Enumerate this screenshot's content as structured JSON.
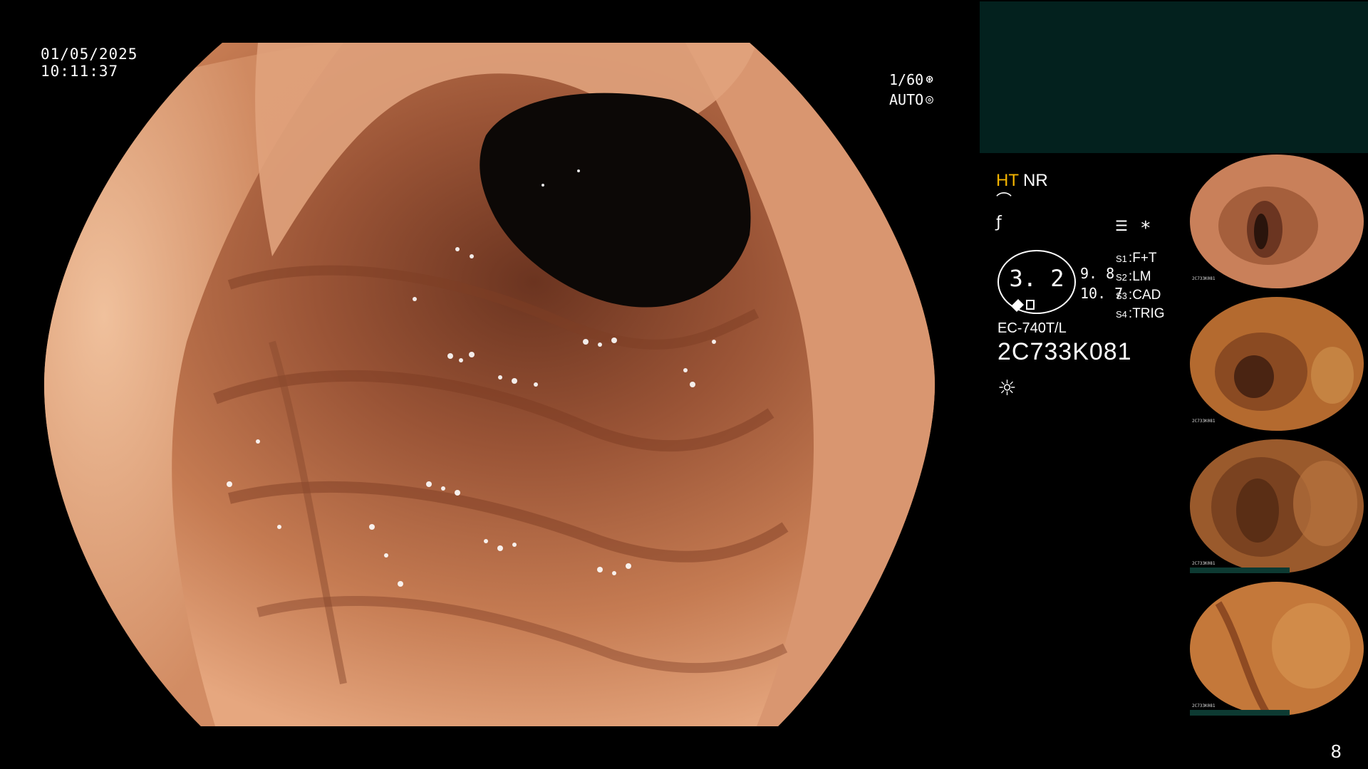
{
  "overlay": {
    "date": "01/05/2025",
    "time": "10:11:37",
    "shutter_speed": "1/60",
    "shutter_icon": "aperture-icon",
    "exposure_mode": "AUTO",
    "exposure_icon": "iris-icon"
  },
  "panel": {
    "mode_ht": "HT",
    "mode_nr": "NR",
    "icon_1": "curve-icon",
    "icon_2": "f-slash-icon",
    "settings_icon": "list-icon",
    "asterisk": "*",
    "dial_value": "3. 2",
    "dial_value_1": "9. 8",
    "dial_value_2": "10. 7",
    "slots": [
      {
        "key": "S1",
        "value": "F+T"
      },
      {
        "key": "S2",
        "value": "LM"
      },
      {
        "key": "S3",
        "value": "CAD"
      },
      {
        "key": "S4",
        "value": "TRIG"
      }
    ],
    "model": "EC-740T/L",
    "serial": "2C733K081",
    "light_icon": "sun-icon"
  },
  "thumbnails": [
    {
      "caption": "2C733K081"
    },
    {
      "caption": "2C733K081"
    },
    {
      "caption": "2C733K081"
    },
    {
      "caption": "2C733K081"
    }
  ],
  "page_number": "8",
  "colors": {
    "teal_box": "#03211e",
    "ht_accent": "#f4b400",
    "mucosa": "#c57b52",
    "lumen": "#0c0806"
  }
}
